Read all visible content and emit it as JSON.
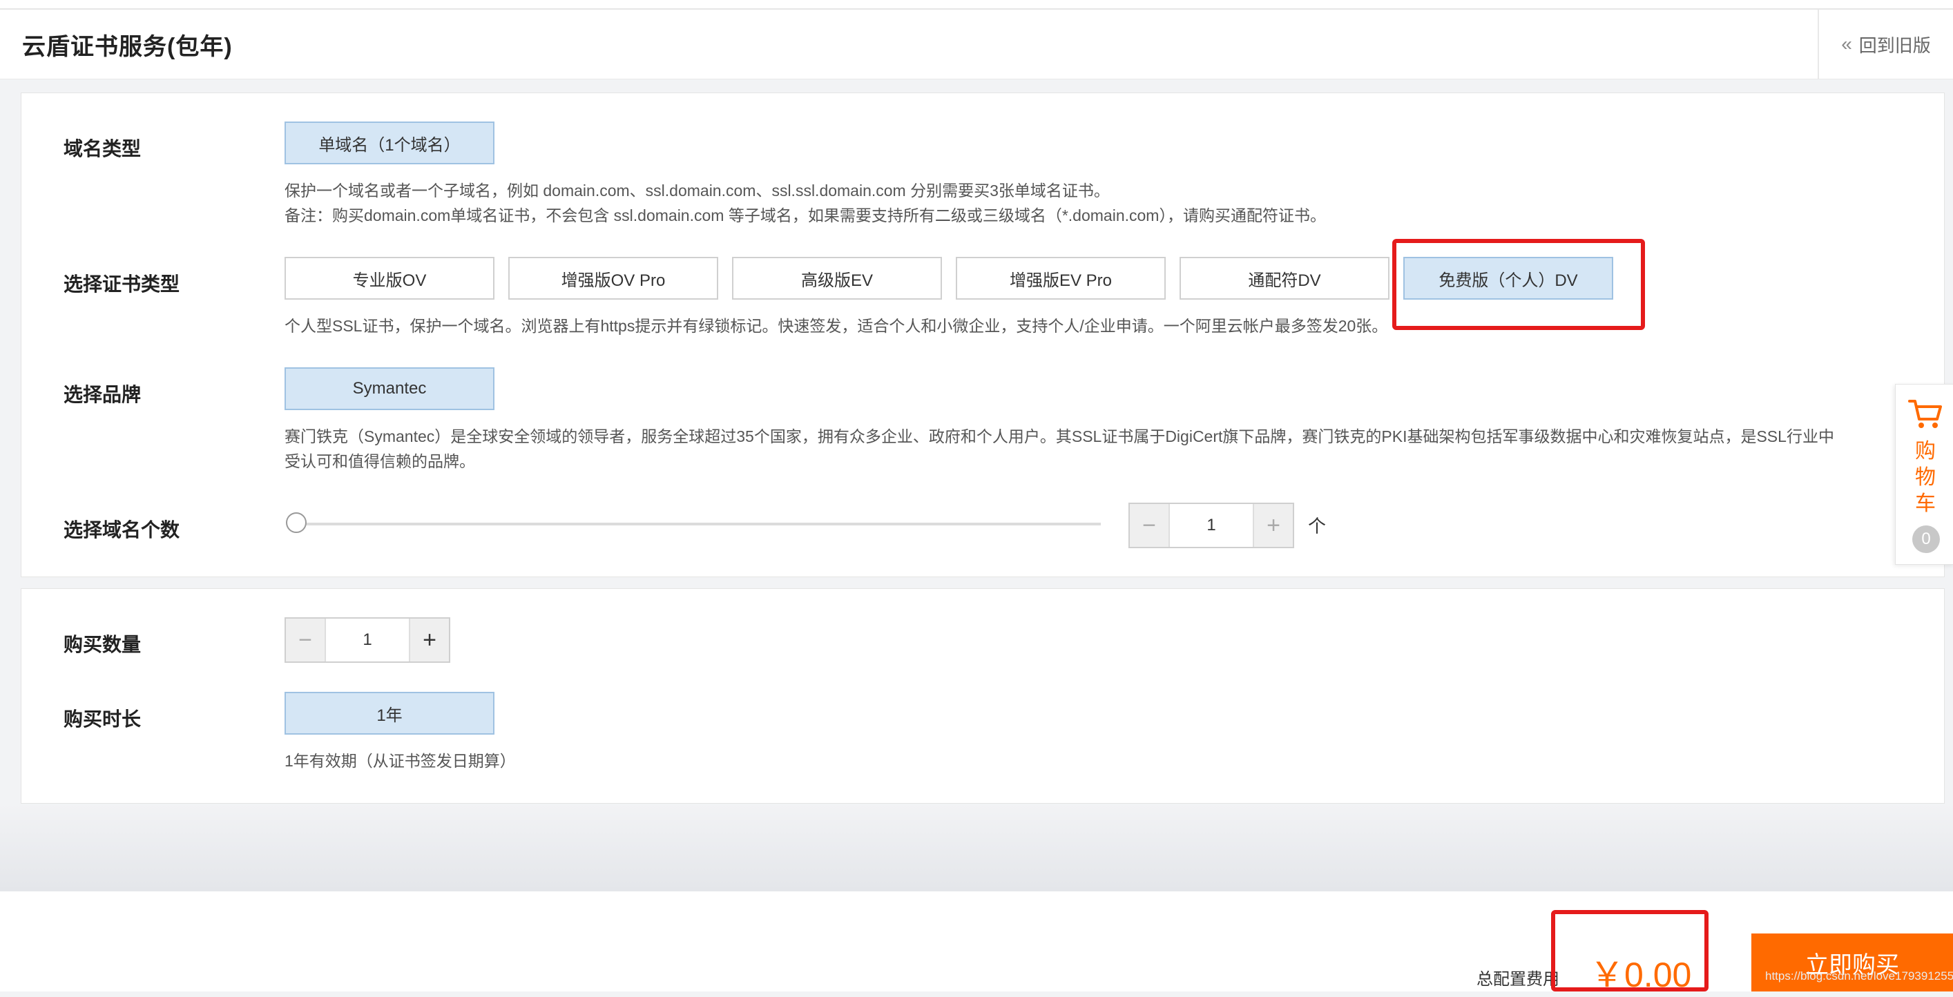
{
  "header": {
    "title": "云盾证书服务(包年)",
    "back_label": "回到旧版"
  },
  "domain_type": {
    "label": "域名类型",
    "option": "单域名（1个域名）",
    "desc_line1": "保护一个域名或者一个子域名，例如 domain.com、ssl.domain.com、ssl.ssl.domain.com 分别需要买3张单域名证书。",
    "desc_line2": "备注：购买domain.com单域名证书，不会包含 ssl.domain.com 等子域名，如果需要支持所有二级或三级域名（*.domain.com），请购买通配符证书。"
  },
  "cert_type": {
    "label": "选择证书类型",
    "options": [
      "专业版OV",
      "增强版OV Pro",
      "高级版EV",
      "增强版EV Pro",
      "通配符DV",
      "免费版（个人）DV"
    ],
    "selected": "免费版（个人）DV",
    "desc": "个人型SSL证书，保护一个域名。浏览器上有https提示并有绿锁标记。快速签发，适合个人和小微企业，支持个人/企业申请。一个阿里云帐户最多签发20张。"
  },
  "brand": {
    "label": "选择品牌",
    "option": "Symantec",
    "desc_line1": "赛门铁克（Symantec）是全球安全领域的领导者，服务全球超过35个国家，拥有众多企业、政府和个人用户。其SSL证书属于DigiCert旗下品牌，赛门铁克的PKI基础架构包括军事级数据中心和灾难恢复站点，是SSL行业中",
    "desc_line2": "受认可和值得信赖的品牌。"
  },
  "domain_count": {
    "label": "选择域名个数",
    "value": "1",
    "unit": "个",
    "minus": "−",
    "plus": "+",
    "slider_fraction": 0
  },
  "quantity": {
    "label": "购买数量",
    "value": "1",
    "minus": "−",
    "plus": "+"
  },
  "duration": {
    "label": "购买时长",
    "option": "1年",
    "desc": "1年有效期（从证书签发日期算）"
  },
  "cart": {
    "label": "购物车",
    "count": "0",
    "icon": "cart-icon"
  },
  "footer": {
    "total_label": "总配置费用",
    "price": "￥0.00",
    "buy_label": "立即购买",
    "watermark": "https://blog.csdn.net/love179391255"
  },
  "colors": {
    "accent": "#ff6a00",
    "selected_bg": "#d5e6f5",
    "highlight": "#e51b1b"
  }
}
